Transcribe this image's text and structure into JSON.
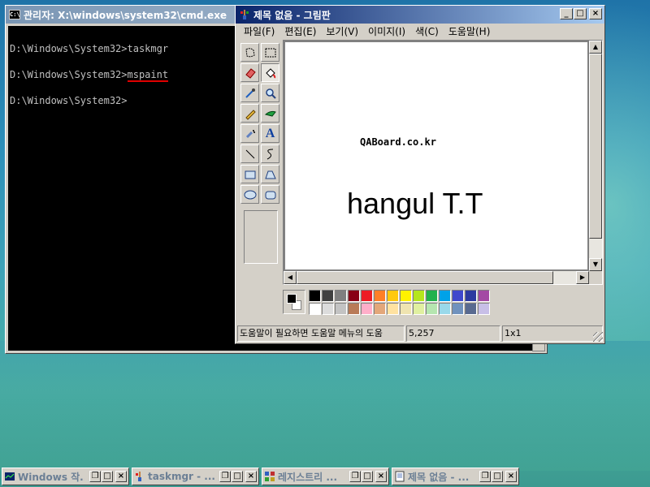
{
  "cmd_window": {
    "title": "관리자: X:\\windows\\system32\\cmd.exe",
    "lines": [
      "D:\\Windows\\System32>taskmgr",
      "D:\\Windows\\System32>",
      "mspaint",
      "D:\\Windows\\System32>"
    ]
  },
  "paint_window": {
    "title": "제목 없음 - 그림판",
    "menu": [
      "파일(F)",
      "편집(E)",
      "보기(V)",
      "이미지(I)",
      "색(C)",
      "도움말(H)"
    ],
    "tools": [
      "free-select",
      "rect-select",
      "eraser",
      "fill-bucket",
      "color-picker",
      "magnifier",
      "pencil",
      "brush",
      "airbrush",
      "text",
      "line",
      "curve",
      "rectangle",
      "polygon",
      "ellipse",
      "rounded-rect"
    ],
    "active_tool": "fill-bucket",
    "canvas_text": {
      "small": "QABoard.co.kr",
      "large": "hangul T.T"
    },
    "foreground_color": "#000000",
    "background_color": "#ffffff",
    "palette": [
      "#000000",
      "#808080",
      "#800000",
      "#808000",
      "#008000",
      "#008080",
      "#000080",
      "#800080",
      "#ffffff",
      "#c0c0c0",
      "#ff0000",
      "#ffff00",
      "#00ff00",
      "#00ffff",
      "#0000ff",
      "#ff00ff"
    ],
    "palette_row1": [
      "#000000",
      "#404040",
      "#7f7f7f",
      "#880015",
      "#ed1c24",
      "#ff7f27",
      "#ffc90e",
      "#fff200",
      "#b5e61d",
      "#22b14c",
      "#00a2e8",
      "#3f48cc",
      "#2d3aa0",
      "#a349a4"
    ],
    "palette_row2": [
      "#ffffff",
      "#dcdcdc",
      "#c3c3c3",
      "#b97a57",
      "#ffaec9",
      "#e3a77a",
      "#ffe2a0",
      "#efe4b0",
      "#e0f0a0",
      "#b5e6b0",
      "#99d9ea",
      "#7092be",
      "#596a90",
      "#c8bfe7"
    ],
    "status": {
      "help": "도움말이 필요하면 도움말 메뉴의 도움",
      "coords": "5,257",
      "empty": "",
      "size": "1x1"
    }
  },
  "taskbar": [
    {
      "label": "Windows 작...",
      "icon": "taskmgr-icon"
    },
    {
      "label": "taskmgr - ...",
      "icon": "paint-brush-icon"
    },
    {
      "label": "레지스트리 ...",
      "icon": "registry-icon"
    },
    {
      "label": "제목 없음 - ...",
      "icon": "notepad-icon"
    }
  ]
}
